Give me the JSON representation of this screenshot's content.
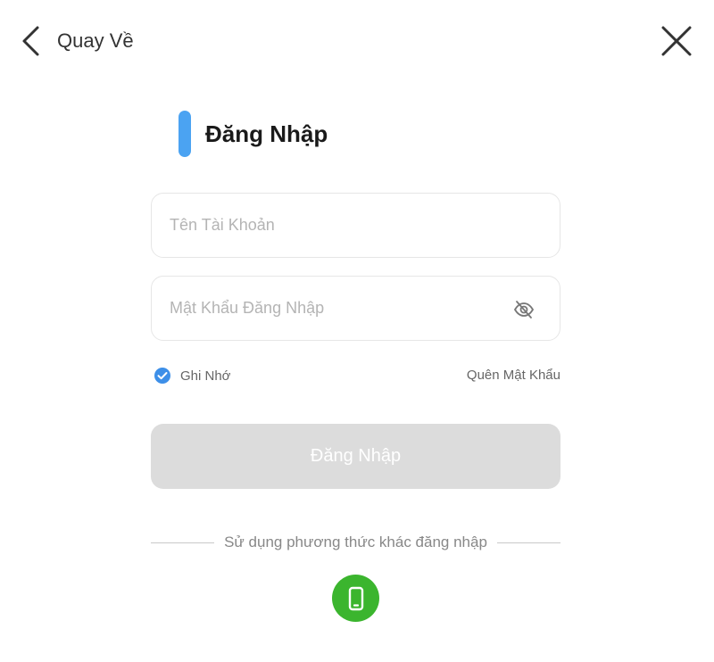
{
  "header": {
    "back_label": "Quay Về"
  },
  "login": {
    "title": "Đăng Nhập",
    "accent_color": "#4ba3f2",
    "username": {
      "value": "",
      "placeholder": "Tên Tài Khoản"
    },
    "password": {
      "value": "",
      "placeholder": "Mật Khẩu Đăng Nhập"
    },
    "remember_label": "Ghi Nhớ",
    "remember_checked": true,
    "forgot_label": "Quên Mật Khẩu",
    "submit_label": "Đăng Nhập",
    "submit_enabled": false
  },
  "alt_login": {
    "divider_text": "Sử dụng phương thức khác đăng nhập",
    "options": [
      {
        "icon": "mobile-phone-icon",
        "color": "#3bb52e"
      }
    ]
  }
}
